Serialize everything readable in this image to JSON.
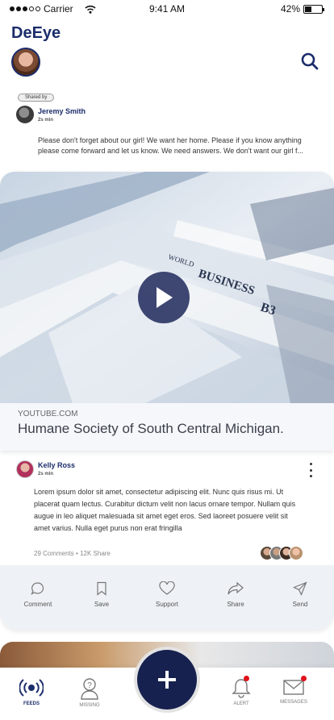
{
  "status_bar": {
    "carrier": "Carrier",
    "time": "9:41 AM",
    "battery": "42%",
    "battery_level": 0.42
  },
  "app": {
    "title": "DeEye"
  },
  "post1": {
    "shared_label": "Shared by",
    "author": "Jeremy Smith",
    "time": "2s min",
    "text": "Please don't forget about our girl! We want her home. Please if you know anything please come forward and let us know. We need answers. We don't want our girl f...",
    "link": {
      "source": "YOUTUBE.COM",
      "title": "Humane Society of South Central Michigan."
    }
  },
  "post2": {
    "author": "Kelly Ross",
    "time": "2s min",
    "text": "Lorem ipsum dolor sit amet, consectetur adipiscing elit. Nunc quis risus mi. Ut placerat quam lectus. Curabitur dictum velit non lacus ornare tempor. Nullam quis augue in leo aliquet malesuada sit amet eget eros. Sed laoreet posuere velit sit amet varius. Nulla eget purus non erat fringilla",
    "comments": "29 Comments",
    "shares": "12K Share",
    "separator": "•"
  },
  "actions": [
    {
      "label": "Comment",
      "icon": "comment-icon"
    },
    {
      "label": "Save",
      "icon": "bookmark-icon"
    },
    {
      "label": "Support",
      "icon": "heart-icon"
    },
    {
      "label": "Share",
      "icon": "share-icon"
    },
    {
      "label": "Send",
      "icon": "send-icon"
    }
  ],
  "nav": [
    {
      "label": "FEEDS",
      "icon": "broadcast-icon",
      "active": true
    },
    {
      "label": "MISSING",
      "icon": "missing-person-icon"
    },
    {
      "label": "ALERT",
      "icon": "bell-icon"
    },
    {
      "label": "MESSAGES",
      "icon": "mail-icon"
    }
  ],
  "colors": {
    "brand": "#1b2d6b",
    "fab": "#16214f",
    "notification": "#e0121b"
  }
}
